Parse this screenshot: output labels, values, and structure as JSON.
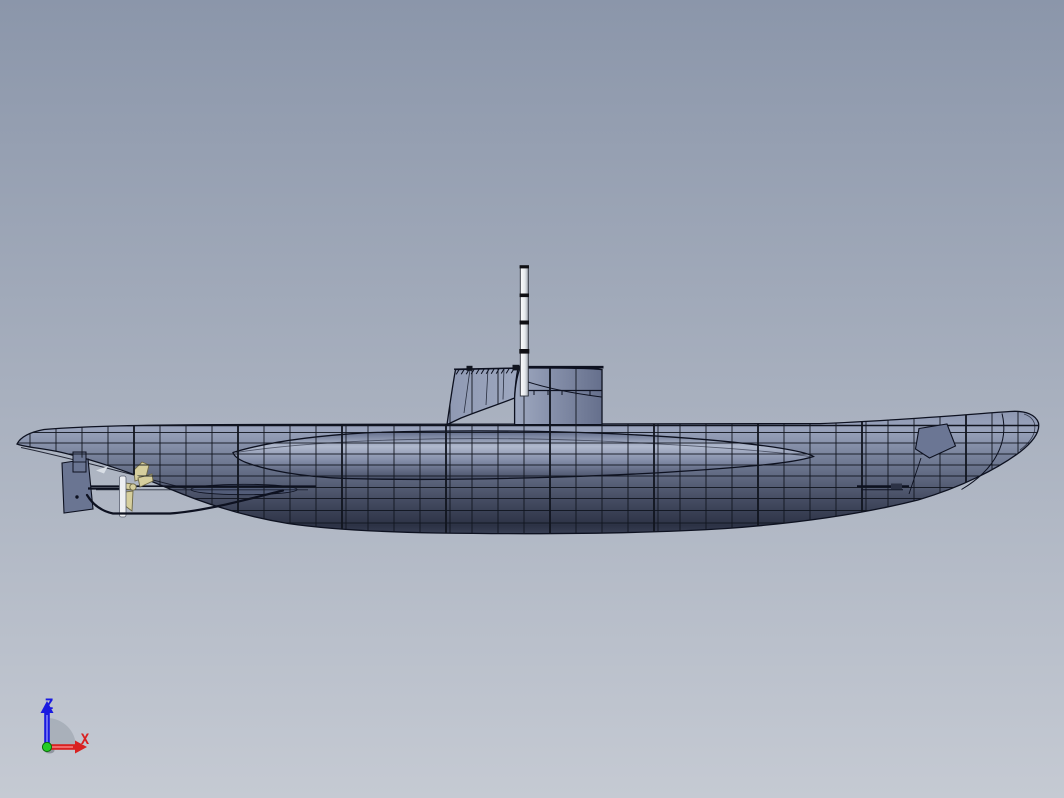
{
  "viewport": {
    "background": {
      "top": "#8b96aa",
      "bottom": "#c5cad3"
    }
  },
  "model": {
    "colors": {
      "wireframe": "#11151f",
      "edge": "#0d1120",
      "hull_top": "#8a94ae",
      "hull_light": "#9aa4bd",
      "hull_mid": "#6d7790",
      "hull_dark": "#454c62",
      "hull_keel": "#2c3245",
      "hull_bottom": "#3c4359",
      "saddle_top": "#5a6584",
      "saddle_light": "#b0b9cd",
      "saddle_mid": "#8690ab",
      "saddle_dark": "#373e55",
      "tower_left": "#8f99b3",
      "tower_mid": "#9da7bf",
      "tower_right": "#646e8b",
      "peri_light": "#ffffff",
      "peri_mid": "#e6e9ed",
      "peri_dark": "#8f96a1",
      "peri_band": "#101014",
      "propeller": "#d6cf9e",
      "propeller_edge": "#6e6845",
      "strut": "#edeff2",
      "rudder": "#6a7592",
      "plate": "#6b7694",
      "stabilizer": "#525c78",
      "anode": "#dfe3ea"
    }
  },
  "triad": {
    "arc_color": "#9aa1ab",
    "origin_color": "#25cc25",
    "z": {
      "label": "Z",
      "color": "#1a1ae0"
    },
    "x": {
      "label": "X",
      "color": "#d92121"
    }
  }
}
